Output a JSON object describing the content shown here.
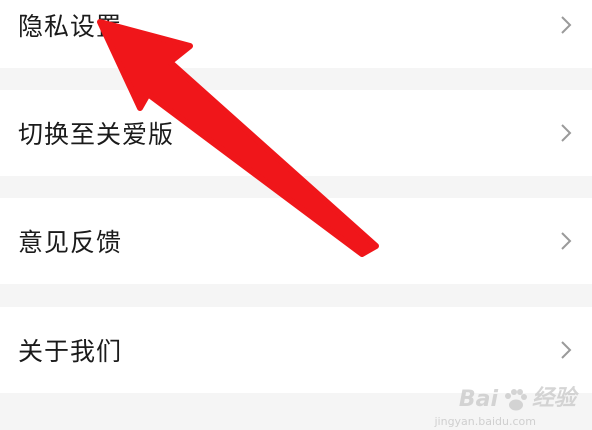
{
  "settings": {
    "items": [
      {
        "label": "隐私设置"
      },
      {
        "label": "切换至关爱版"
      },
      {
        "label": "意见反馈"
      },
      {
        "label": "关于我们"
      }
    ]
  },
  "watermark": {
    "brand": "Bai",
    "brand2": "经验",
    "url": "jingyan.baidu.com"
  },
  "colors": {
    "arrow": "#f0161a",
    "row_bg": "#ffffff",
    "gap_bg": "#f5f5f5",
    "chevron": "#9a9a9a"
  },
  "icons": {
    "chevron": "chevron-right-icon",
    "arrow": "annotation-arrow-icon",
    "paw": "baidu-paw-icon"
  }
}
